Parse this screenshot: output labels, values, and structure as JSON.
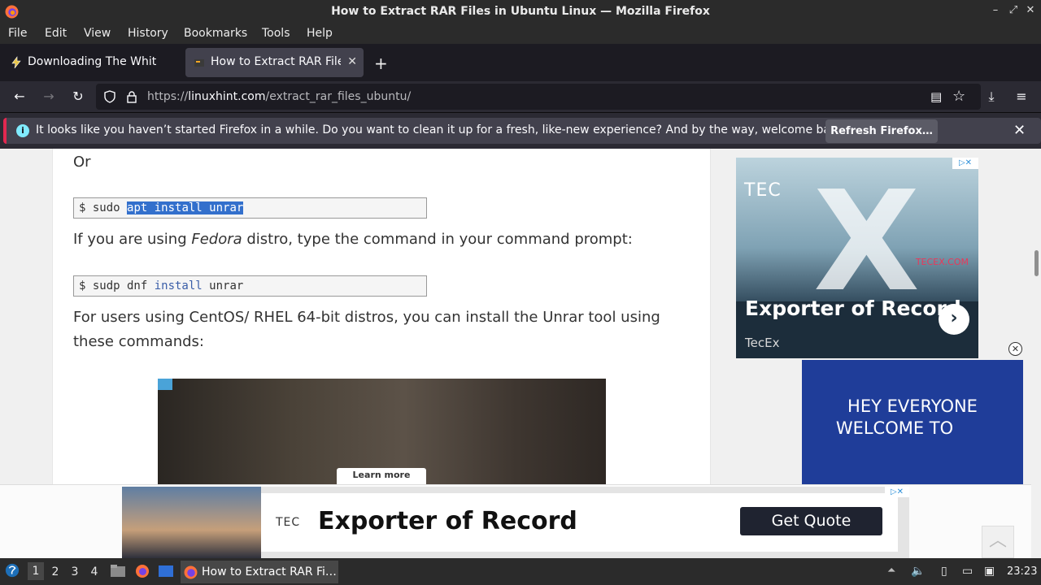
{
  "window": {
    "title": "How to Extract RAR Files in Ubuntu Linux — Mozilla Firefox"
  },
  "menu": [
    "File",
    "Edit",
    "View",
    "History",
    "Bookmarks",
    "Tools",
    "Help"
  ],
  "tabs": [
    {
      "label": "Downloading The White R",
      "active": false
    },
    {
      "label": "How to Extract RAR Files",
      "active": true
    }
  ],
  "url": {
    "prefix": "https://",
    "domain": "linuxhint.com",
    "path": "/extract_rar_files_ubuntu/"
  },
  "notification": {
    "message": "It looks like you haven’t started Firefox in a while. Do you want to clean it up for a fresh, like-new experience? And by the way, welcome back!",
    "button": "Refresh Firefox…"
  },
  "article": {
    "or": "Or",
    "code1": {
      "prompt": "$ sudo ",
      "selected": "apt install unrar"
    },
    "fedora_pre": "If you are using ",
    "fedora_em": "Fedora",
    "fedora_post": " distro, type the command in your command prompt:",
    "code2": {
      "prompt": "$ sudp dnf ",
      "kw": "install",
      "rest": " unrar"
    },
    "centos_line1": "For users using CentOS/ RHEL 64-bit distros, you can install the Unrar tool using",
    "centos_line2": "these commands:",
    "photo_cta": "Learn more"
  },
  "ads": {
    "side1": {
      "brand": "TEC",
      "domain": "TECEX.COM",
      "headline": "Exporter of Record",
      "sub": "TecEx"
    },
    "side2": {
      "line1": "HEY EVERYONE",
      "line2": "WELCOME TO"
    },
    "bottom": {
      "brand": "TEC",
      "headline": "Exporter of Record",
      "cta": "Get Quote"
    }
  },
  "taskbar": {
    "workspaces": [
      "1",
      "2",
      "3",
      "4"
    ],
    "active_workspace": "1",
    "window_label": "How to Extract RAR Fi…",
    "clock": "23:23"
  }
}
